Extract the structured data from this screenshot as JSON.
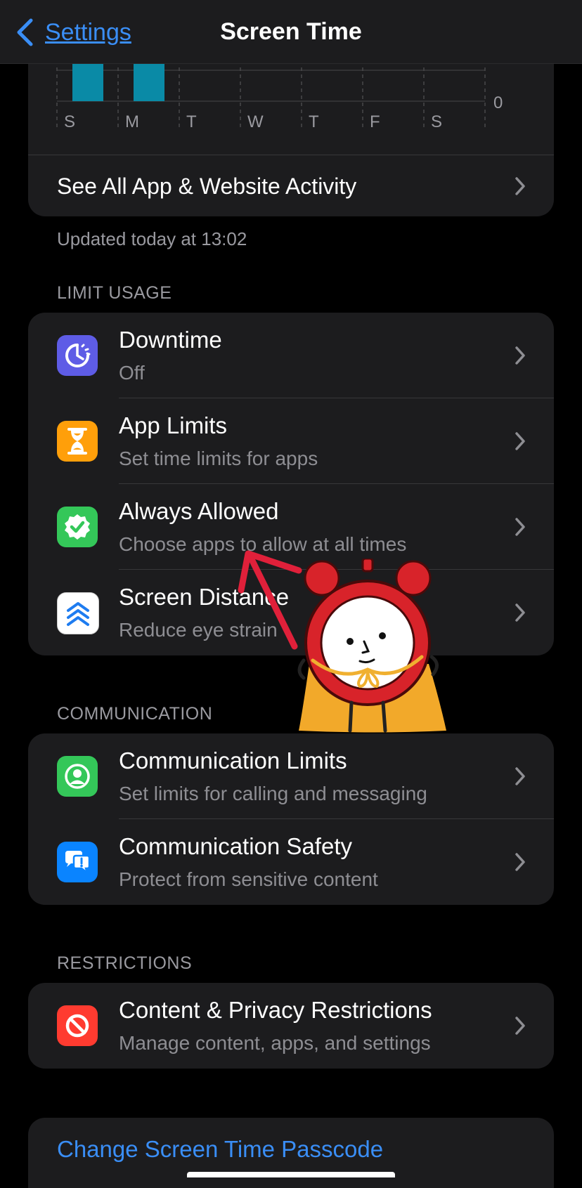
{
  "nav": {
    "back_label": "Settings",
    "title": "Screen Time"
  },
  "chart_data": {
    "type": "bar",
    "categories": [
      "S",
      "M",
      "T",
      "W",
      "T",
      "F",
      "S"
    ],
    "y_tick_label": "0",
    "bar_color": "#0a8aa6"
  },
  "activity": {
    "see_all_label": "See All App & Website Activity",
    "updated_text": "Updated today at 13:02"
  },
  "sections": {
    "limit_usage": "LIMIT USAGE",
    "communication": "COMMUNICATION",
    "restrictions": "RESTRICTIONS"
  },
  "limit_usage_rows": [
    {
      "title": "Downtime",
      "subtitle": "Off",
      "icon": "downtime-icon",
      "color": "#5e5ce6"
    },
    {
      "title": "App Limits",
      "subtitle": "Set time limits for apps",
      "icon": "hourglass-icon",
      "color": "#ff9f0a"
    },
    {
      "title": "Always Allowed",
      "subtitle": "Choose apps to allow at all times",
      "icon": "checkmark-seal-icon",
      "color": "#34c759"
    },
    {
      "title": "Screen Distance",
      "subtitle": "Reduce eye strain",
      "icon": "screen-distance-icon",
      "color": "#ffffff"
    }
  ],
  "communication_rows": [
    {
      "title": "Communication Limits",
      "subtitle": "Set limits for calling and messaging",
      "icon": "person-circle-icon",
      "color": "#34c759"
    },
    {
      "title": "Communication Safety",
      "subtitle": "Protect from sensitive content",
      "icon": "chat-bubbles-icon",
      "color": "#0a84ff"
    }
  ],
  "restrictions_rows": [
    {
      "title": "Content & Privacy Restrictions",
      "subtitle": "Manage content, apps, and settings",
      "icon": "prohibited-icon",
      "color": "#ff3b30"
    }
  ],
  "passcode": {
    "label": "Change Screen Time Passcode"
  }
}
